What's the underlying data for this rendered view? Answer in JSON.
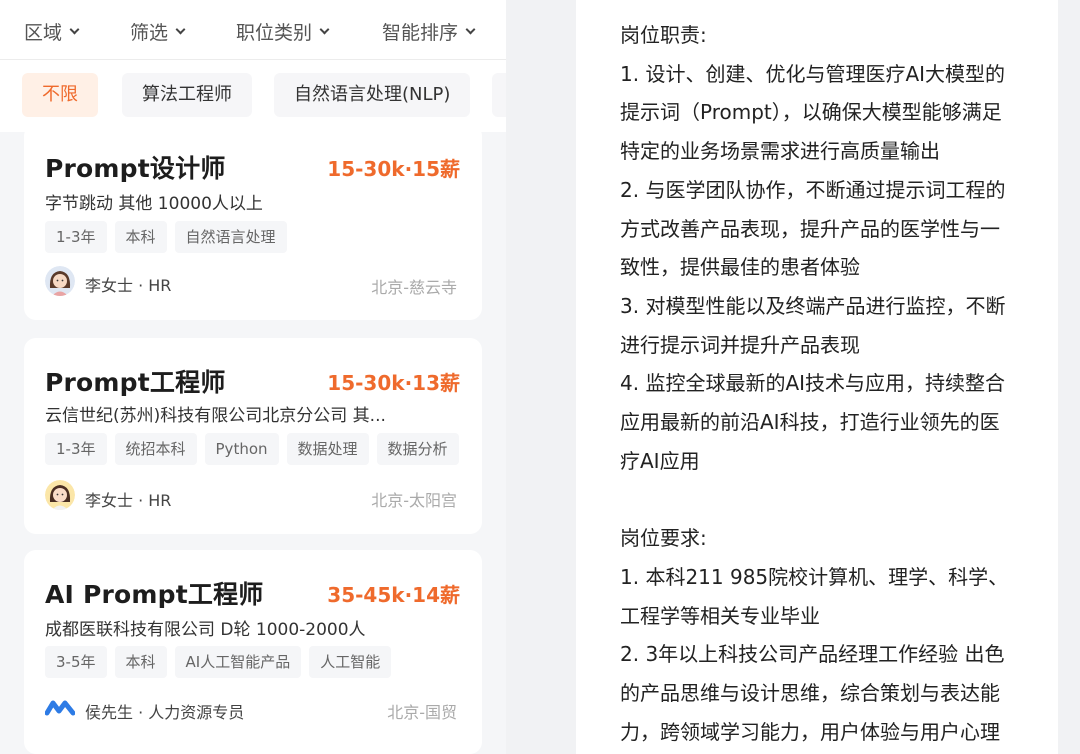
{
  "filters": [
    "区域",
    "筛选",
    "职位类别",
    "智能排序"
  ],
  "chips": [
    "不限",
    "算法工程师",
    "自然语言处理(NLP)",
    ""
  ],
  "accent_color": "#ef6a2c",
  "jobs": [
    {
      "title": "Prompt设计师",
      "salary": "15-30k·15薪",
      "company": "字节跳动  其他  10000人以上",
      "tags": [
        "1-3年",
        "本科",
        "自然语言处理"
      ],
      "recruiter": "李女士 · HR",
      "location": "北京-慈云寺",
      "avatar": "woman-avatar"
    },
    {
      "title": "Prompt工程师",
      "salary": "15-30k·13薪",
      "company": "云信世纪(苏州)科技有限公司北京分公司  其...",
      "tags": [
        "1-3年",
        "统招本科",
        "Python",
        "数据处理",
        "数据分析"
      ],
      "recruiter": "李女士 · HR",
      "location": "北京-太阳宫",
      "avatar": "woman-avatar"
    },
    {
      "title": "AI Prompt工程师",
      "salary": "35-45k·14薪",
      "company": "成都医联科技有限公司  D轮  1000-2000人",
      "tags": [
        "3-5年",
        "本科",
        "AI人工智能产品",
        "人工智能"
      ],
      "recruiter": "侯先生 · 人力资源专员",
      "location": "北京-国贸",
      "avatar": "company-logo"
    }
  ],
  "description_lines": [
    "岗位职责:",
    "1. 设计、创建、优化与管理医疗AI大模型的",
    "提示词（Prompt），以确保大模型能够满足",
    "特定的业务场景需求进行高质量输出",
    "2. 与医学团队协作，不断通过提示词工程的",
    "方式改善产品表现，提升产品的医学性与一",
    "致性，提供最佳的患者体验",
    "3. 对模型性能以及终端产品进行监控，不断",
    "进行提示词并提升产品表现",
    "4. 监控全球最新的AI技术与应用，持续整合",
    "应用最新的前沿AI科技，打造行业领先的医",
    "疗AI应用",
    "",
    "岗位要求:",
    "1. 本科211 985院校计算机、理学、科学、",
    "工程学等相关专业毕业",
    "2. 3年以上科技公司产品经理工作经验 出色",
    "的产品思维与设计思维，综合策划与表达能",
    "力，跨领域学习能力，用户体验与用户心理"
  ]
}
